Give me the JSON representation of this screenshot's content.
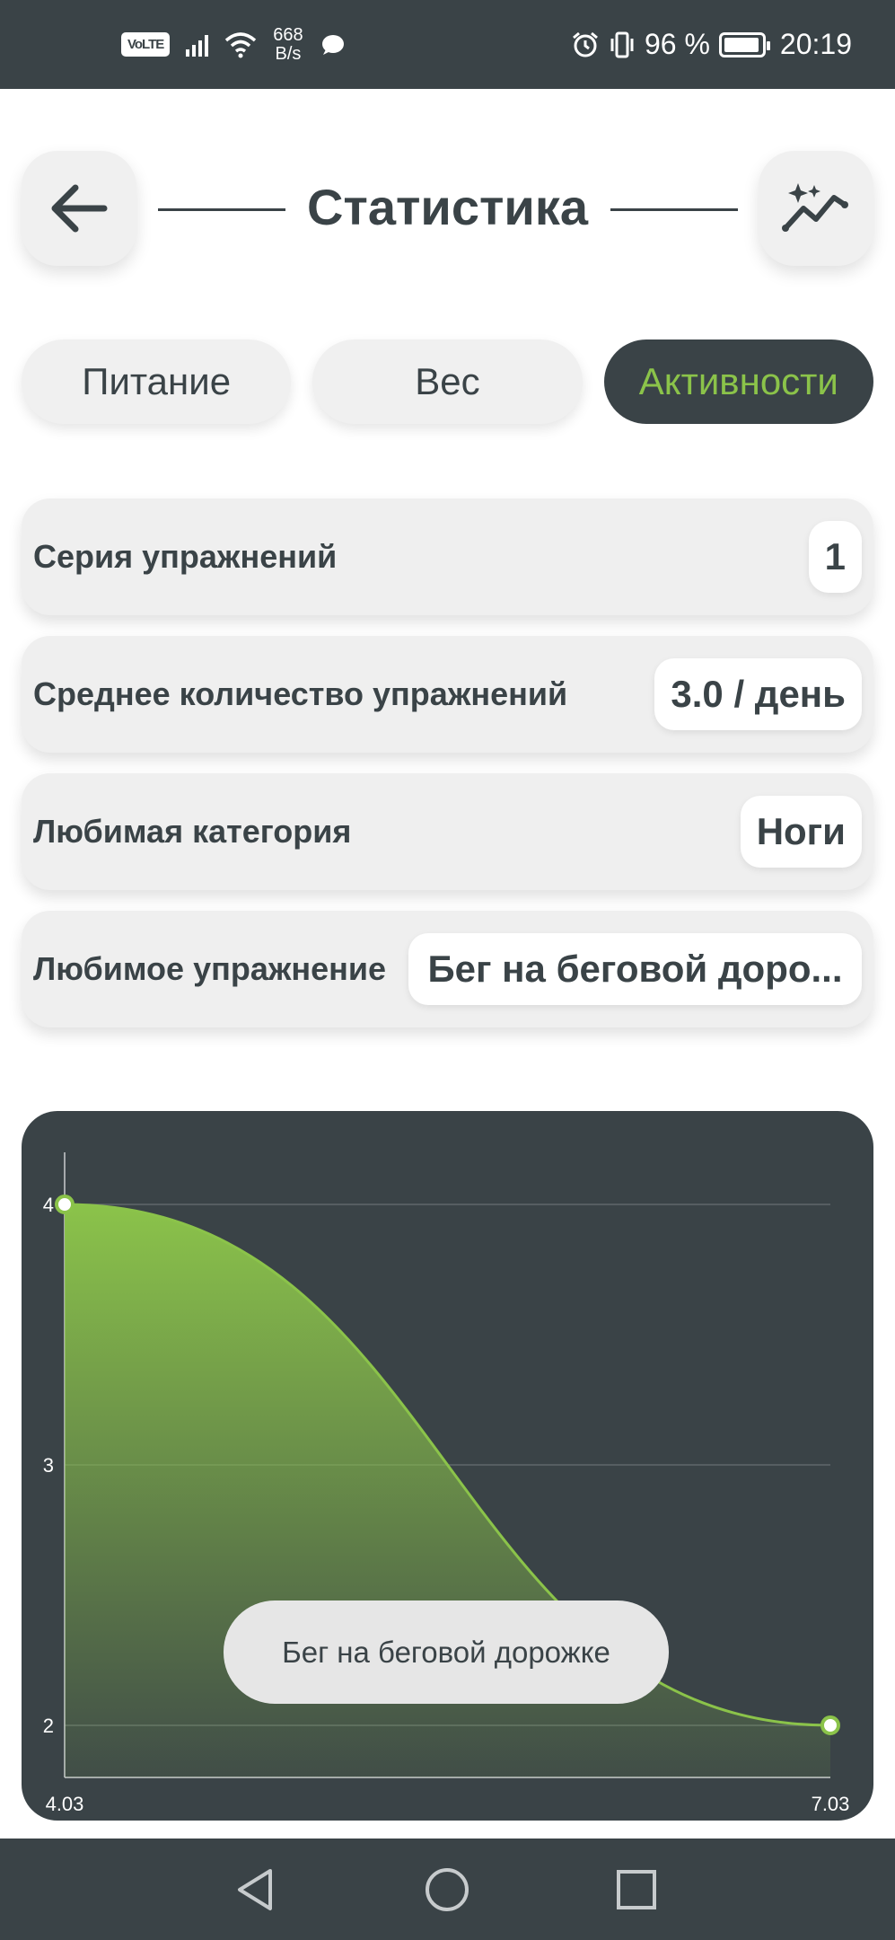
{
  "status_bar": {
    "volte": "VoLTE",
    "speed_value": "668",
    "speed_unit": "B/s",
    "battery_percent": "96 %",
    "time": "20:19",
    "battery_level": 0.96
  },
  "header": {
    "title": "Статистика",
    "back_icon": "arrow-left-icon",
    "stats_icon": "sparkle-trend-icon"
  },
  "tabs": [
    {
      "label": "Питание",
      "active": false
    },
    {
      "label": "Вес",
      "active": false
    },
    {
      "label": "Активности",
      "active": true
    }
  ],
  "stats": [
    {
      "label": "Серия упражнений",
      "value": "1"
    },
    {
      "label": "Среднее количество упражнений",
      "value": "3.0 / день"
    },
    {
      "label": "Любимая категория",
      "value": "Ноги"
    },
    {
      "label": "Любимое упражнение",
      "value": "Бег на беговой доро..."
    }
  ],
  "chart_data": {
    "type": "area",
    "x": [
      "4.03",
      "7.03"
    ],
    "values": [
      4,
      2
    ],
    "y_ticks": [
      "2",
      "3",
      "4"
    ],
    "ylim": [
      2,
      4
    ],
    "grid": true,
    "tooltip": "Бег на беговой дорожке",
    "colors": {
      "line": "#8bc34a",
      "background": "#3a4347"
    }
  },
  "nav_bar": {
    "back_icon": "triangle-back-icon",
    "home_icon": "circle-home-icon",
    "recents_icon": "square-recents-icon"
  },
  "colors": {
    "primary_dark": "#3a4347",
    "accent_green": "#8bc34a",
    "card_bg": "#efefef"
  }
}
